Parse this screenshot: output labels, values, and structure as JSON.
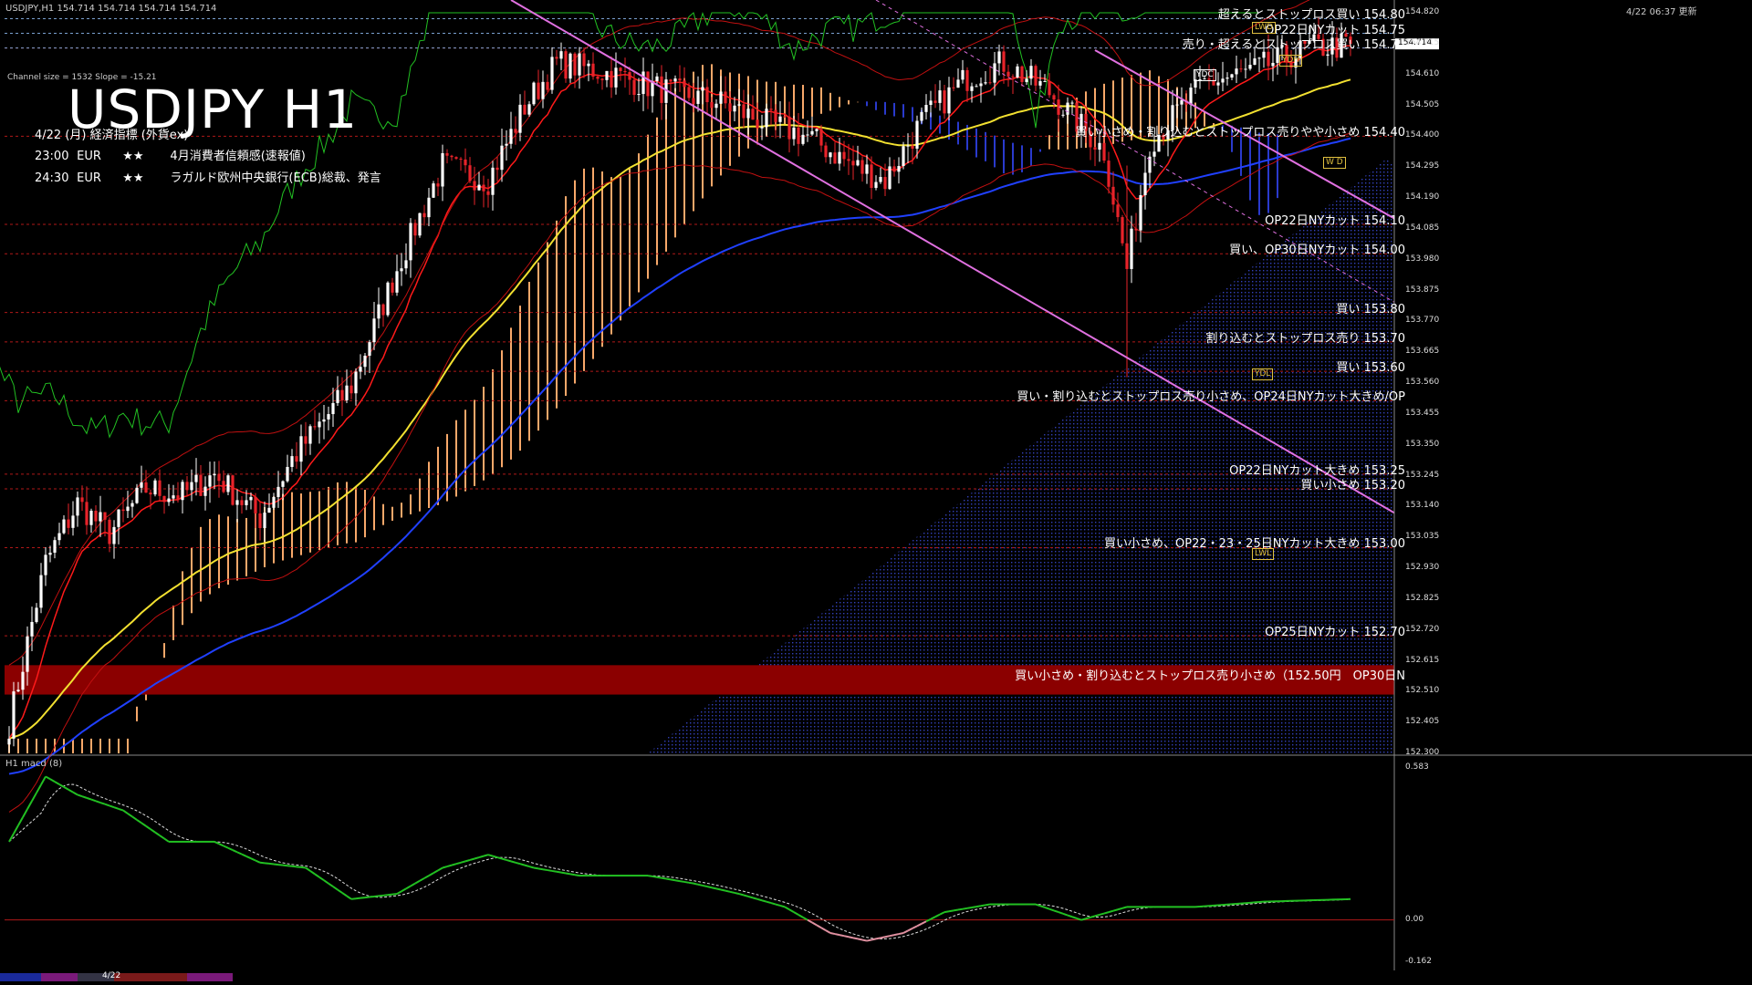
{
  "header": {
    "top_left": "USDJPY,H1  154.714 154.714 154.714 154.714",
    "top_right": "4/22 06:37 更新",
    "channel_info": "Channel size = 1532 Slope = -15.21",
    "title": "USDJPY H1",
    "subtitle": "4/22 (月) 経済指標 (外貨ex)"
  },
  "events": [
    {
      "time": "23:00",
      "currency": "EUR",
      "stars": "★★",
      "name": "4月消費者信頼感(速報値)"
    },
    {
      "time": "24:30",
      "currency": "EUR",
      "stars": "★★",
      "name": "ラガルド欧州中央銀行(ECB)総裁、発言"
    }
  ],
  "orders": [
    {
      "text": "超えるとストップロス買い 154.80",
      "price": 154.8
    },
    {
      "text": "OP22日NYカット 154.75",
      "price": 154.75
    },
    {
      "text": "売り・超えるとストップロス買い 154.70",
      "price": 154.7
    },
    {
      "text": "買い小さめ・割り込むとストップロス売りやや小さめ 154.40",
      "price": 154.4
    },
    {
      "text": "OP22日NYカット 154.10",
      "price": 154.1
    },
    {
      "text": "買い、OP30日NYカット 154.00",
      "price": 154.0
    },
    {
      "text": "買い 153.80",
      "price": 153.8
    },
    {
      "text": "割り込むとストップロス売り 153.70",
      "price": 153.7
    },
    {
      "text": "買い 153.60",
      "price": 153.6
    },
    {
      "text": "買い・割り込むとストップロス売り小さめ、OP24日NYカット大きめ/OP",
      "price": 153.5
    },
    {
      "text": "OP22日NYカット大きめ 153.25",
      "price": 153.25
    },
    {
      "text": "買い小さめ 153.20",
      "price": 153.2
    },
    {
      "text": "買い小さめ、OP22・23・25日NYカット大きめ 153.00",
      "price": 153.0
    },
    {
      "text": "OP25日NYカット 152.70",
      "price": 152.7
    },
    {
      "text": "買い小さめ・割り込むとストップロス売り小さめ（152.50円　OP30日N",
      "price": 152.55
    }
  ],
  "tags": [
    {
      "text": "LWD",
      "price": 154.77,
      "color": "#e0c040"
    },
    {
      "text": "YDH",
      "price": 154.66,
      "color": "#e0c040"
    },
    {
      "text": "YDC",
      "price": 154.61,
      "color": "#ffffff"
    },
    {
      "text": "W D",
      "price": 154.31,
      "color": "#e0c040"
    },
    {
      "text": "YDL",
      "price": 153.59,
      "color": "#e0c040"
    },
    {
      "text": "LWL",
      "price": 152.98,
      "color": "#e0c040"
    }
  ],
  "current_price_label": "154.714",
  "colors": {
    "up": "#ffffff",
    "down": "#e8232a",
    "kumo": "#f7a86a",
    "kumo_bear": "#2a3acd",
    "ma_yellow": "#f2e030",
    "ma_blue": "#2040ff",
    "tenkan": "#ff1a1a",
    "green": "#22c022",
    "channel": "#e070e0",
    "band": "#8b0000"
  },
  "chart_data": {
    "type": "candlestick",
    "title": "USDJPY H1",
    "ylim": [
      152.3,
      154.82
    ],
    "y_ticks": [
      "154.820",
      "154.715",
      "154.610",
      "154.505",
      "154.400",
      "154.295",
      "154.190",
      "154.085",
      "153.980",
      "153.875",
      "153.770",
      "153.665",
      "153.560",
      "153.455",
      "153.350",
      "153.245",
      "153.140",
      "153.035",
      "152.930",
      "152.825",
      "152.720",
      "152.615",
      "152.510",
      "152.405",
      "152.300"
    ],
    "last_price": 154.714,
    "anchors": [
      [
        0,
        152.4
      ],
      [
        8,
        152.95
      ],
      [
        15,
        153.15
      ],
      [
        22,
        153.05
      ],
      [
        30,
        153.2
      ],
      [
        38,
        153.18
      ],
      [
        45,
        153.25
      ],
      [
        55,
        153.1
      ],
      [
        62,
        153.3
      ],
      [
        75,
        153.55
      ],
      [
        85,
        153.95
      ],
      [
        95,
        154.3
      ],
      [
        105,
        154.25
      ],
      [
        113,
        154.5
      ],
      [
        120,
        154.65
      ],
      [
        130,
        154.62
      ],
      [
        145,
        154.55
      ],
      [
        155,
        154.52
      ],
      [
        165,
        154.45
      ],
      [
        175,
        154.4
      ],
      [
        185,
        154.3
      ],
      [
        192,
        154.25
      ],
      [
        200,
        154.45
      ],
      [
        210,
        154.6
      ],
      [
        218,
        154.65
      ],
      [
        228,
        154.55
      ],
      [
        240,
        154.35
      ],
      [
        245,
        153.95
      ],
      [
        250,
        154.38
      ],
      [
        262,
        154.58
      ],
      [
        272,
        154.62
      ],
      [
        285,
        154.7
      ],
      [
        294,
        154.71
      ]
    ],
    "macd_ylim": [
      -0.162,
      0.583
    ],
    "macd_ticks": [
      "0.583",
      "0.00",
      "-0.162"
    ],
    "macd_title": "H1  macd (8)",
    "macd_anchors": [
      [
        0,
        0.3
      ],
      [
        8,
        0.55
      ],
      [
        15,
        0.48
      ],
      [
        25,
        0.42
      ],
      [
        35,
        0.3
      ],
      [
        45,
        0.3
      ],
      [
        55,
        0.22
      ],
      [
        65,
        0.2
      ],
      [
        75,
        0.08
      ],
      [
        85,
        0.1
      ],
      [
        95,
        0.2
      ],
      [
        105,
        0.25
      ],
      [
        115,
        0.2
      ],
      [
        125,
        0.17
      ],
      [
        140,
        0.17
      ],
      [
        150,
        0.14
      ],
      [
        160,
        0.1
      ],
      [
        170,
        0.05
      ],
      [
        180,
        -0.05
      ],
      [
        188,
        -0.08
      ],
      [
        196,
        -0.05
      ],
      [
        205,
        0.03
      ],
      [
        215,
        0.06
      ],
      [
        225,
        0.06
      ],
      [
        235,
        0.0
      ],
      [
        245,
        0.05
      ],
      [
        260,
        0.05
      ],
      [
        275,
        0.07
      ],
      [
        294,
        0.08
      ]
    ],
    "bottom_date": "4/22"
  }
}
